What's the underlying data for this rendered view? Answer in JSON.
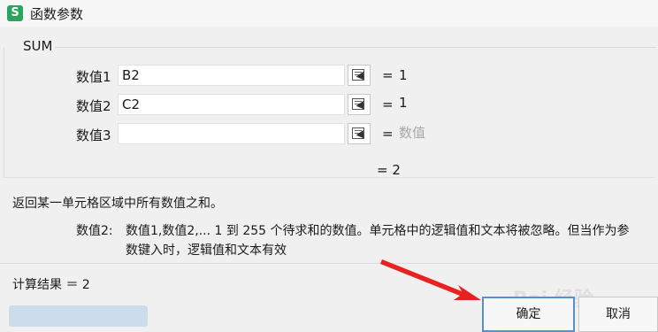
{
  "window": {
    "title": "函数参数",
    "app_icon_letter": "S"
  },
  "function_group": {
    "name": "SUM"
  },
  "args": [
    {
      "label": "数值1",
      "value": "B2",
      "eq": "=",
      "result": "1"
    },
    {
      "label": "数值2",
      "value": "C2",
      "eq": "=",
      "result": "1"
    },
    {
      "label": "数值3",
      "value": "",
      "eq": "=",
      "result": "数值"
    }
  ],
  "total": "= 2",
  "description": "返回某一单元格区域中所有数值之和。",
  "param_help": {
    "name": "数值2:",
    "line1": "数值1,数值2,... 1 到 255 个待求和的数值。单元格中的逻辑值和文本将被忽略。但当作为参",
    "line2": "数键入时，逻辑值和文本有效"
  },
  "calc_result": "计算结果 ＝ 2",
  "buttons": {
    "ok": "确定",
    "cancel": "取消"
  },
  "watermark": "Bai 经验",
  "colors": {
    "accent": "#5a8ecf",
    "annotation_arrow": "#e8231f",
    "app_icon": "#2aa65c"
  }
}
